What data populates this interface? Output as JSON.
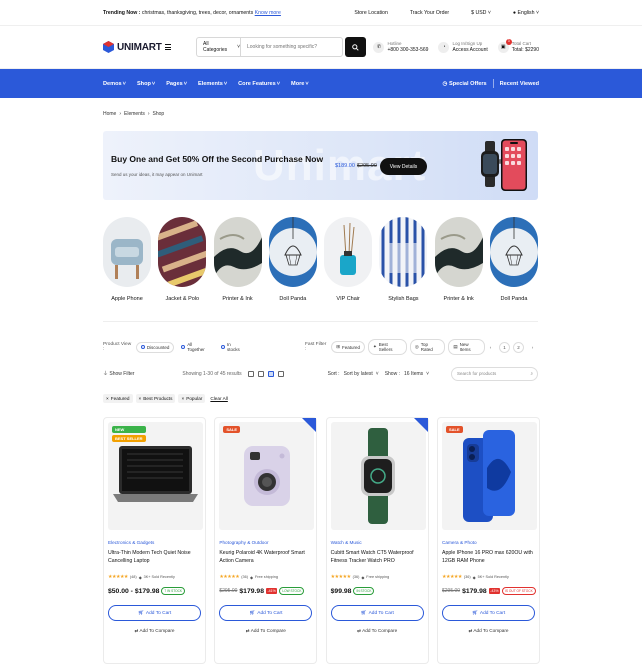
{
  "topbar": {
    "trending_label": "Trending Now :",
    "trending_text": "christmas, thanksgiving, trees, decor, ornaments",
    "know_more": "Know more",
    "store_location": "Store Location",
    "track_order": "Track Your Order",
    "currency": "$ USD",
    "language": "English"
  },
  "header": {
    "brand": "UNIMART",
    "category_select": "All Categories",
    "search_placeholder": "Looking for something specific?",
    "hotline_label": "Hotline",
    "hotline_number": "+800 300-353-569",
    "account_label": "Log In/Sign Up",
    "account_sub": "Access Account",
    "cart_label": "Total Cart",
    "cart_total": "Total: $2290",
    "cart_count": "3"
  },
  "nav": {
    "items": [
      "Demos",
      "Shop",
      "Pages",
      "Elements",
      "Core Features",
      "More"
    ],
    "special_offers": "Special Offers",
    "recent_viewed": "Recent Viewed"
  },
  "breadcrumb": [
    "Home",
    "Elements",
    "Shop"
  ],
  "banner": {
    "title": "Buy One and Get 50% Off the Second Purchase Now",
    "subtitle": "Send us your ideas, it may appear on Unimart",
    "ghost": "Unimart",
    "price": "$189.00",
    "old_price": "$295.00",
    "button": "View Details"
  },
  "categories": [
    {
      "label": "Apple Phone",
      "icon": "armchair"
    },
    {
      "label": "Jacket & Polo",
      "icon": "fabric"
    },
    {
      "label": "Printer & Ink",
      "icon": "marble"
    },
    {
      "label": "Doll Panda",
      "icon": "lamp"
    },
    {
      "label": "VIP Chair",
      "icon": "diffuser"
    },
    {
      "label": "Stylish Bags",
      "icon": "stripes"
    },
    {
      "label": "Printer & Ink",
      "icon": "marble"
    },
    {
      "label": "Doll Panda",
      "icon": "lamp"
    }
  ],
  "product_view": {
    "label": "Product View :",
    "options": [
      "Discounted",
      "All Together",
      "In stocks"
    ],
    "fast_filter_label": "Fast Filter :",
    "fast_filters": [
      "Featured",
      "Best Sellers",
      "Top Rated",
      "New Items"
    ],
    "pages": [
      "1",
      "2"
    ]
  },
  "toolbar": {
    "show_filter": "Show Filter",
    "showing": "Showing 1-30 of 45 results",
    "sort_label": "Sort :",
    "sort_value": "Sort by latest",
    "show_label": "Show :",
    "show_value": "16 Items",
    "search_placeholder": "Search for products"
  },
  "active_filters": [
    "Featured",
    "Best Products",
    "Popular"
  ],
  "clear_all": "Clear All",
  "products": [
    {
      "tags": [
        "NEW",
        "BEST SELLER"
      ],
      "category": "Electronics & Gadgets",
      "name": "Ultra-Thin Modern Tech Quiet Noise Cancelling Laptop",
      "reviews": "(48)",
      "meta": "3K+ Sold Recently",
      "price": "$50.00 - $179.98",
      "old_price": "",
      "discount": "",
      "stock": "7 IN STOCK",
      "add_to_cart": "Add To Cart",
      "compare": "Add To Compare"
    },
    {
      "tags": [
        "SALE"
      ],
      "category": "Photography & Outdoor",
      "name": "Keurig Polaroid 4K Waterproof Smart Action Camera",
      "reviews": "(36)",
      "meta": "Free shipping",
      "price": "$179.98",
      "old_price": "$295.00",
      "discount": "-41%",
      "stock": "LOW STOCK",
      "add_to_cart": "Add To Cart",
      "compare": "Add To Compare"
    },
    {
      "tags": [],
      "category": "Watch & Music",
      "name": "Cubitt Smart Watch CT5 Waterproof Fitness Tracker Watch PRO",
      "reviews": "(36)",
      "meta": "Free shipping",
      "price": "$99.98",
      "old_price": "",
      "discount": "",
      "stock": "IN STOCK",
      "add_to_cart": "Add To Cart",
      "compare": "Add To Compare"
    },
    {
      "tags": [
        "SALE"
      ],
      "category": "Camera & Photo",
      "name": "Apple IPhone 16 PRO max 620OU with 12GB RAM Phone",
      "reviews": "(36)",
      "meta": "5K+ Sold Recently",
      "price": "$179.98",
      "old_price": "$295.00",
      "discount": "-43%",
      "stock": "IS OUT OF STOCK",
      "add_to_cart": "Add To Cart",
      "compare": "Add To Compare"
    }
  ],
  "colors": {
    "accent": "#2b59d9",
    "sale": "#e3522a",
    "new": "#3bb34a",
    "best": "#f2a000",
    "star": "#f5a623"
  }
}
